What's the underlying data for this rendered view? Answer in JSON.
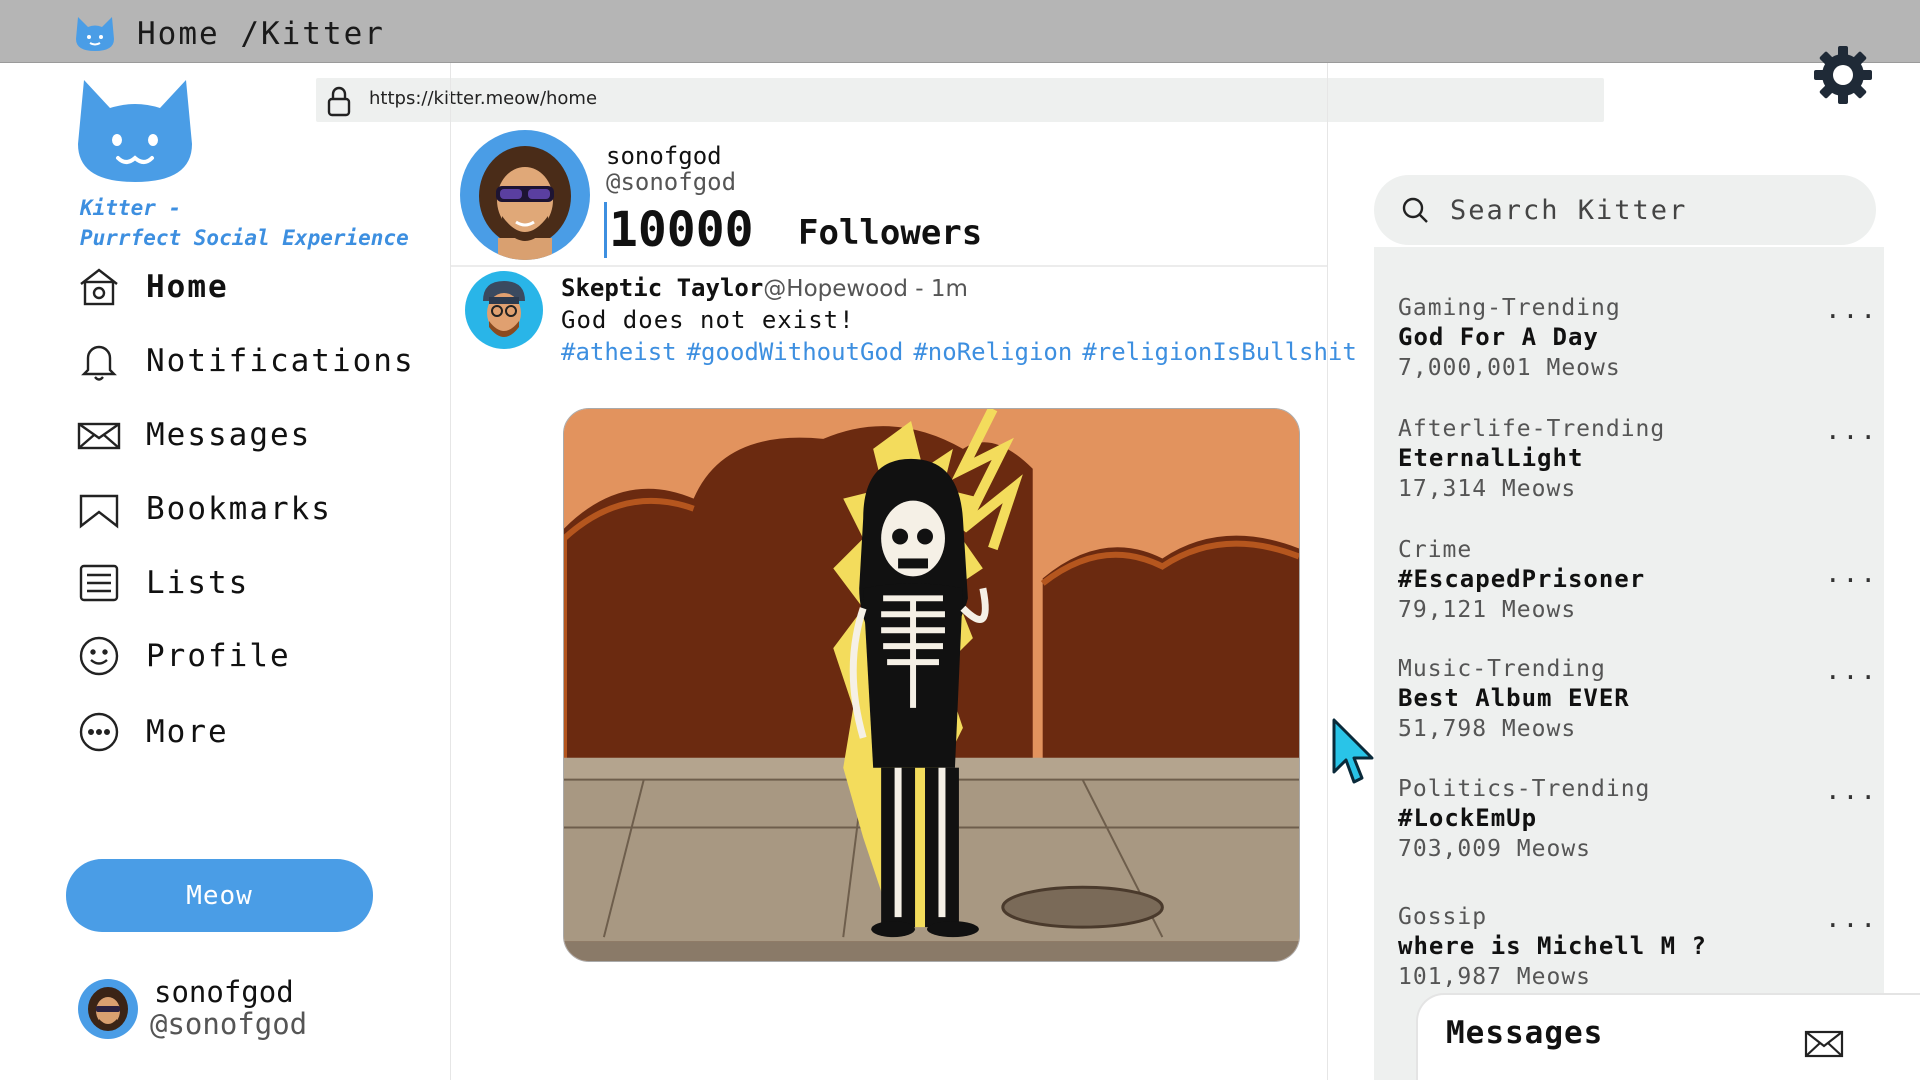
{
  "topbar": {
    "breadcrumb": "Home /Kitter"
  },
  "address_bar": {
    "url": "https://kitter.meow/home"
  },
  "brand": {
    "tagline_line1": "Kitter -",
    "tagline_line2": "Purrfect Social Experience",
    "accent": "#4a9de6"
  },
  "nav": {
    "items": [
      {
        "label": "Home",
        "icon": "home-icon",
        "active": true
      },
      {
        "label": "Notifications",
        "icon": "bell-icon"
      },
      {
        "label": "Messages",
        "icon": "envelope-icon"
      },
      {
        "label": "Bookmarks",
        "icon": "bookmark-icon"
      },
      {
        "label": "Lists",
        "icon": "list-icon"
      },
      {
        "label": "Profile",
        "icon": "smiley-icon"
      },
      {
        "label": "More",
        "icon": "more-icon"
      }
    ],
    "meow_button": "Meow"
  },
  "current_user": {
    "name": "sonofgod",
    "handle": "@sonofgod"
  },
  "profile": {
    "name": "sonofgod",
    "handle": "@sonofgod",
    "followers_count": "10000",
    "followers_label": "Followers"
  },
  "post": {
    "author": "Skeptic Taylor",
    "meta": "@Hopewood - 1m",
    "text": "God does not exist!",
    "hashtags": [
      "#atheist",
      "#goodWithoutGod",
      "#noReligion",
      "#religionIsBullshit"
    ]
  },
  "search": {
    "placeholder": "Search Kitter"
  },
  "trends": [
    {
      "category": "Gaming-Trending",
      "title": "God For A Day",
      "count": "7,000,001 Meows"
    },
    {
      "category": "Afterlife-Trending",
      "title": "EternalLight",
      "count": "17,314 Meows"
    },
    {
      "category": "Crime",
      "title": "#EscapedPrisoner",
      "count": "79,121 Meows"
    },
    {
      "category": "Music-Trending",
      "title": "Best Album EVER",
      "count": "51,798 Meows"
    },
    {
      "category": "Politics-Trending",
      "title": "#LockEmUp",
      "count": "703,009 Meows"
    },
    {
      "category": "Gossip",
      "title": "where is Michell M ?",
      "count": "101,987 Meows"
    }
  ],
  "trend_more": "...",
  "messages_panel": {
    "title": "Messages"
  }
}
